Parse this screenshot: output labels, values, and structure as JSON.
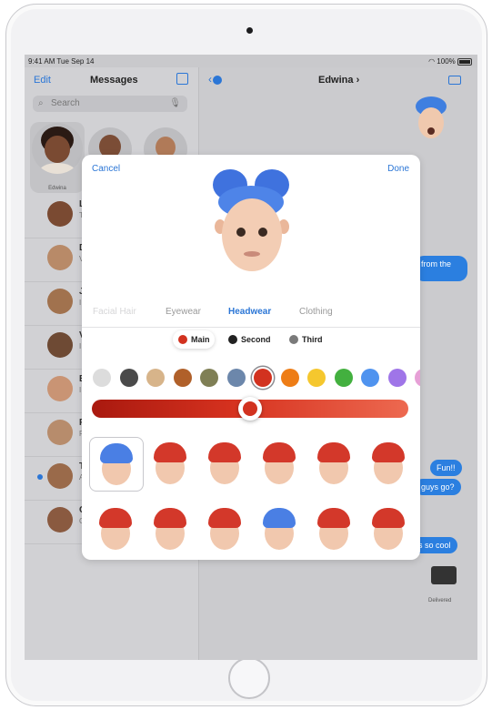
{
  "status": {
    "time_date": "9:41 AM  Tue Sep 14",
    "battery": "100%"
  },
  "sidebar": {
    "edit": "Edit",
    "title": "Messages",
    "search_placeholder": "Search",
    "pinned_name": "Edwina",
    "rows": [
      {
        "letter": "L",
        "sub": "T"
      },
      {
        "letter": "D",
        "sub": "V"
      },
      {
        "letter": "J",
        "sub": "I"
      },
      {
        "letter": "V",
        "sub": "I"
      },
      {
        "letter": "E",
        "sub": "I"
      },
      {
        "letter": "R",
        "sub": "F"
      },
      {
        "letter": "T",
        "sub": "A"
      },
      {
        "letter": "C",
        "sub": "C"
      }
    ]
  },
  "conversation": {
    "back_count": "1",
    "title": "Edwina",
    "bubbles": [
      "from the",
      "Fun!!",
      "guys go?",
      "s so cool"
    ],
    "delivered": "Delivered"
  },
  "editor": {
    "cancel": "Cancel",
    "done": "Done",
    "tabs": [
      "Facial Hair",
      "Eyewear",
      "Headwear",
      "Clothing"
    ],
    "active_tab": "Headwear",
    "color_targets": [
      {
        "label": "Main",
        "color": "#d2321f"
      },
      {
        "label": "Second",
        "color": "#222222"
      },
      {
        "label": "Third",
        "color": "#7a7a7a"
      }
    ],
    "palette": [
      "#dcdcdc",
      "#4a4a4a",
      "#d7b48a",
      "#b0602a",
      "#7f7f55",
      "#6c87ab",
      "#d2321f",
      "#ee7d16",
      "#f5c72e",
      "#43b03f",
      "#4f93ef",
      "#9f75e8",
      "#e6a0d6"
    ],
    "selected_palette_index": 6,
    "slider_fraction": 0.5,
    "headwear_options": [
      "blue-braids",
      "red-beanie",
      "red-cap-goggles",
      "red-bun-beanie",
      "red-beanie",
      "red-helmet",
      "red-goggles-cap",
      "red-beanie",
      "red-band-cap",
      "blue-headband",
      "red-beanie",
      "red-cap"
    ]
  }
}
